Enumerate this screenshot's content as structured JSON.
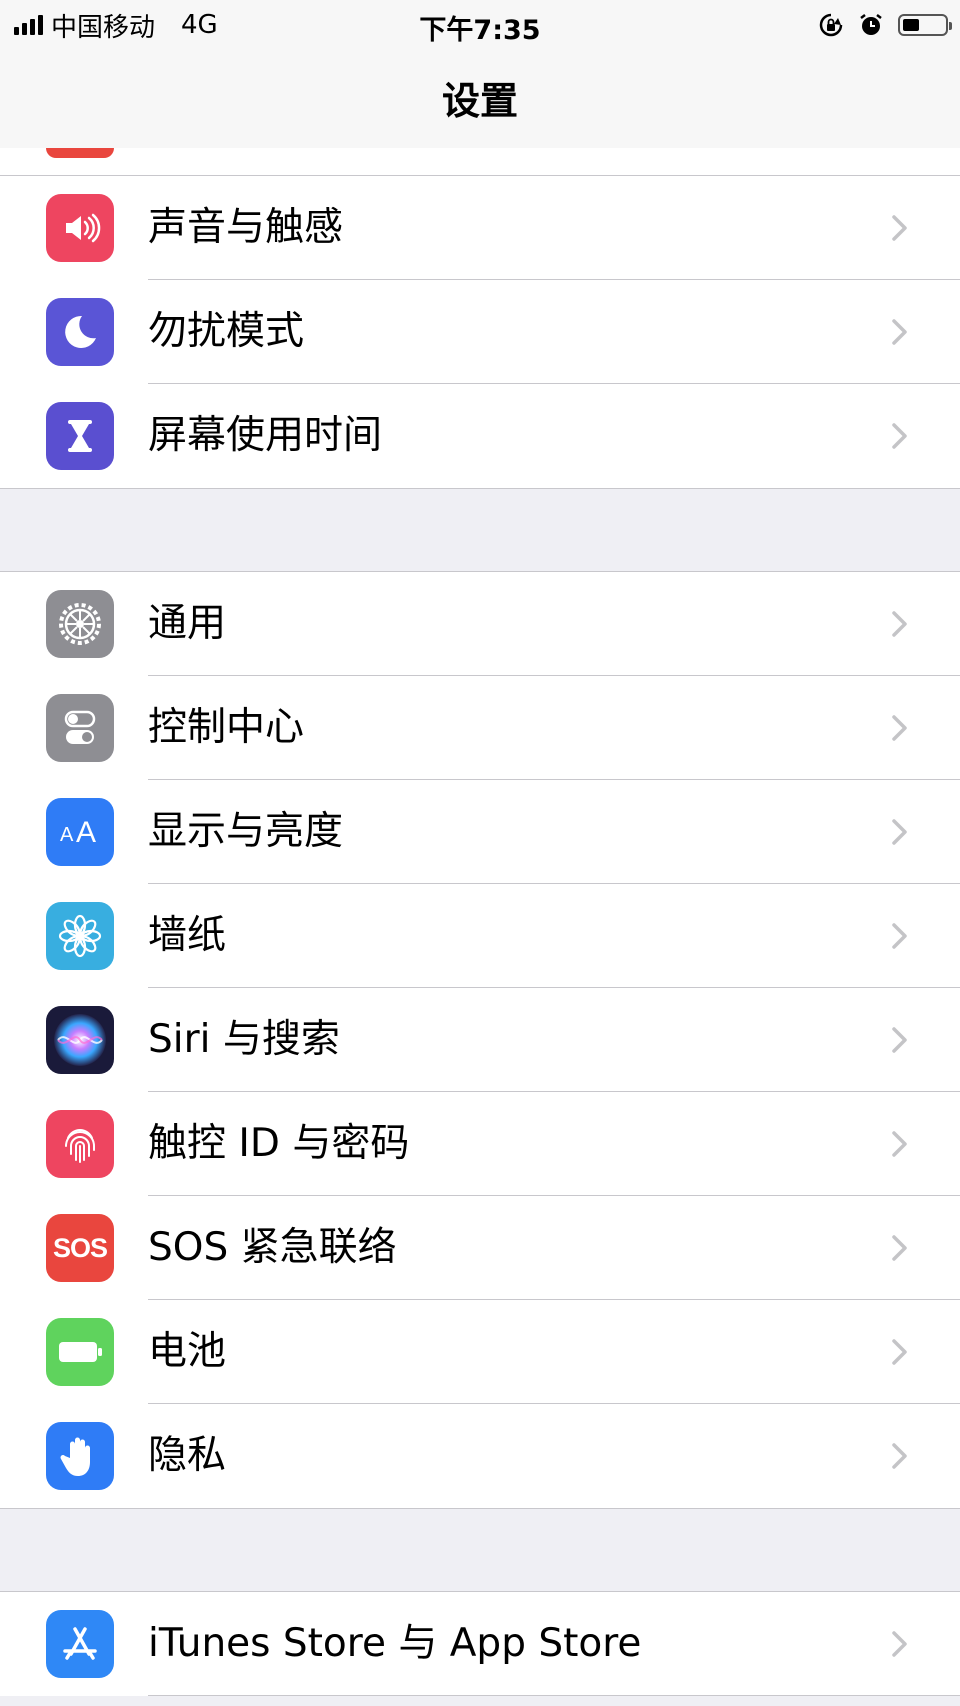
{
  "status_bar": {
    "carrier": "中国移动",
    "network": "4G",
    "time": "下午7:35",
    "battery_level": 0.4
  },
  "nav": {
    "title": "设置"
  },
  "groups": [
    {
      "items": [
        {
          "label": "声音与触感",
          "icon": "sound-icon",
          "color": "#ee4560"
        },
        {
          "label": "勿扰模式",
          "icon": "moon-icon",
          "color": "#5a55d6"
        },
        {
          "label": "屏幕使用时间",
          "icon": "hourglass-icon",
          "color": "#5a4fd0"
        }
      ]
    },
    {
      "items": [
        {
          "label": "通用",
          "icon": "gear-icon",
          "color": "#8e8e93"
        },
        {
          "label": "控制中心",
          "icon": "toggles-icon",
          "color": "#8e8e93"
        },
        {
          "label": "显示与亮度",
          "icon": "text-size-icon",
          "color": "#2f7cf6"
        },
        {
          "label": "墙纸",
          "icon": "flower-icon",
          "color": "#38aee0"
        },
        {
          "label": "Siri 与搜索",
          "icon": "siri-icon",
          "color": "#1a1a3a"
        },
        {
          "label": "触控 ID 与密码",
          "icon": "fingerprint-icon",
          "color": "#ee4560"
        },
        {
          "label": "SOS 紧急联络",
          "icon": "sos-icon",
          "color": "#e9463e",
          "icon_text": "SOS"
        },
        {
          "label": "电池",
          "icon": "battery-icon",
          "color": "#5fd35d"
        },
        {
          "label": "隐私",
          "icon": "hand-icon",
          "color": "#2f7cf6"
        }
      ]
    },
    {
      "items": [
        {
          "label": "iTunes Store 与 App Store",
          "icon": "app-store-icon",
          "color": "#2f88f6"
        }
      ]
    }
  ]
}
